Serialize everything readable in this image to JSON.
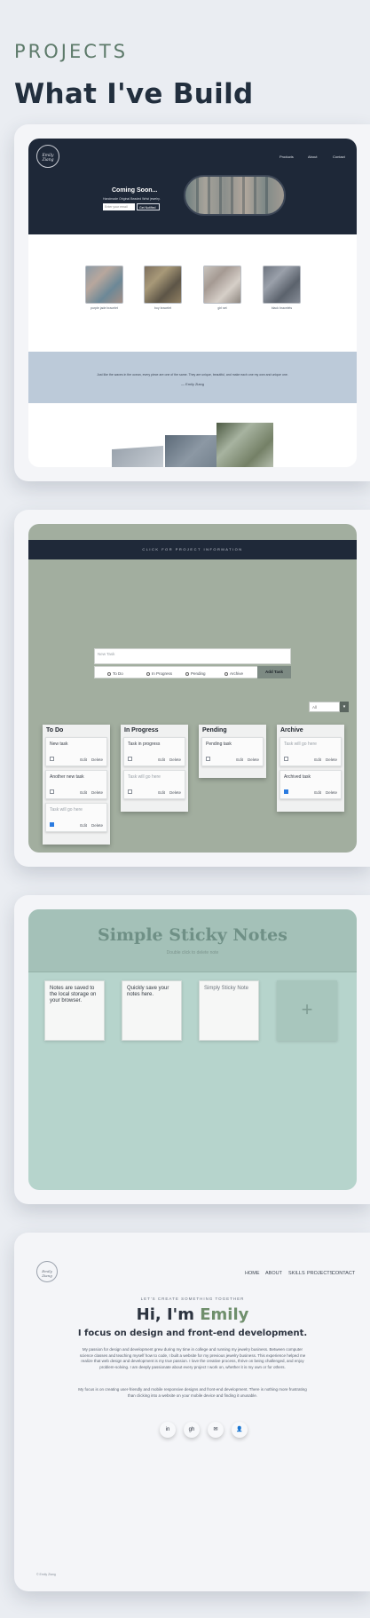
{
  "header": {
    "kicker": "PROJECTS",
    "title": "What I've Build"
  },
  "project1": {
    "logo_text": "Emily Ziang",
    "nav": [
      "Products",
      "About",
      "Contact"
    ],
    "hero_heading": "Coming Soon...",
    "hero_sub": "Handmade Original Beaded Wrist jewelry.",
    "email_placeholder": "Enter your email",
    "notify_button": "Get Notified",
    "products": [
      {
        "label": "purple jade bracelet",
        "icon": "bracelet-photo-1"
      },
      {
        "label": "boy bracelet",
        "icon": "bracelet-photo-2"
      },
      {
        "label": "girl set",
        "icon": "bracelet-photo-3"
      },
      {
        "label": "black bracelets",
        "icon": "bracelet-photo-4"
      }
    ],
    "band_text": "Just like the waves in the ocean, every piece are one of the same. They are unique, beautiful, and make each one my own and unique one.",
    "band_sub": "— Emily Ziang"
  },
  "project2": {
    "banner": "CLICK FOR PROJECT INFORMATION",
    "task_placeholder": "New Task",
    "statuses": [
      "To Do",
      "In Progress",
      "Pending",
      "Archive"
    ],
    "add_button": "Add Task",
    "filter_value": "All",
    "columns": [
      {
        "title": "To Do",
        "tasks": [
          {
            "text": "New task",
            "checked": false,
            "placeholder": false
          },
          {
            "text": "Another new task",
            "checked": false,
            "placeholder": false
          },
          {
            "text": "Task will go here",
            "checked": true,
            "placeholder": true
          }
        ]
      },
      {
        "title": "In Progress",
        "tasks": [
          {
            "text": "Task in progress",
            "checked": false,
            "placeholder": false
          },
          {
            "text": "Task will go here",
            "checked": false,
            "placeholder": true
          }
        ]
      },
      {
        "title": "Pending",
        "tasks": [
          {
            "text": "Pending task",
            "checked": false,
            "placeholder": false
          }
        ]
      },
      {
        "title": "Archive",
        "tasks": [
          {
            "text": "Task will go here",
            "checked": false,
            "placeholder": true
          },
          {
            "text": "Archived task",
            "checked": true,
            "placeholder": false
          }
        ]
      }
    ],
    "edit_label": "Edit",
    "delete_label": "Delete"
  },
  "project3": {
    "title": "Simple Sticky Notes",
    "subtitle": "Double click to delete note",
    "notes": [
      "Notes are saved to the local storage on your browser.",
      "Quickly save your notes here.",
      "Simply Sticky Note"
    ],
    "add_symbol": "+"
  },
  "project4": {
    "logo_text": "Emily Ziang",
    "nav": [
      "HOME",
      "ABOUT",
      "SKILLS",
      "PROJECTS",
      "CONTACT"
    ],
    "kicker": "LET'S CREATE SOMETHING TOGETHER",
    "hi": "Hi, I'm ",
    "name": "Emily",
    "headline": "I focus on design and front-end development.",
    "para1": "My passion for design and development grew during my time in college and running my jewelry business. Between computer science classes and teaching myself how to code, I built a website for my previous jewelry business. This experience helped me realize that web design and development is my true passion. I love the creative process, thrive on being challenged, and enjoy problem-solving. I am deeply passionate about every project I work on, whether it is my own or for others.",
    "para2": "My focus is on creating user-friendly and mobile responsive designs and front-end development. There is nothing more frustrating than clicking into a website on your mobile device and finding it unusable.",
    "socials": [
      "in",
      "gh",
      "✉",
      "👤"
    ],
    "footer": "© Emily Ziang"
  },
  "colors": {
    "navy": "#1e2838",
    "sage": "#a2ae9f",
    "mint": "#b6d4cc",
    "accent_green": "#6f8f6c"
  }
}
